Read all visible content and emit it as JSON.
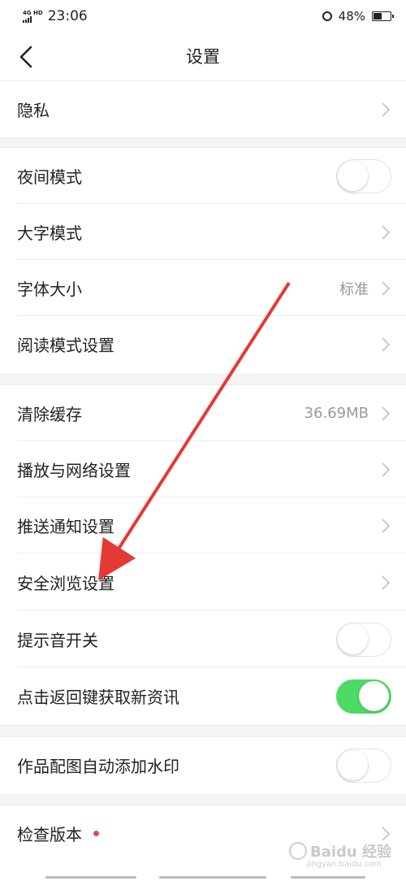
{
  "status_bar": {
    "network": "4G HD",
    "time": "23:06",
    "battery": "48%"
  },
  "navbar": {
    "title": "设置"
  },
  "rows": {
    "privacy": {
      "label": "隐私"
    },
    "night_mode": {
      "label": "夜间模式",
      "on": false
    },
    "large_font_mode": {
      "label": "大字模式"
    },
    "font_size": {
      "label": "字体大小",
      "value": "标准"
    },
    "reading_mode": {
      "label": "阅读模式设置"
    },
    "clear_cache": {
      "label": "清除缓存",
      "value": "36.69MB"
    },
    "playback_network": {
      "label": "播放与网络设置"
    },
    "push_notification": {
      "label": "推送通知设置"
    },
    "safe_browsing": {
      "label": "安全浏览设置"
    },
    "sound_switch": {
      "label": "提示音开关",
      "on": false
    },
    "back_refresh": {
      "label": "点击返回键获取新资讯",
      "on": true
    },
    "watermark": {
      "label": "作品配图自动添加水印",
      "on": false
    },
    "check_version": {
      "label": "检查版本"
    }
  },
  "watermark_logo": {
    "brand": "Baidu 经验",
    "sub": "jingyan.baidu.com"
  },
  "colors": {
    "toggle_on": "#4cd964",
    "annotation_arrow": "#e53935",
    "badge_dot": "#e8484c"
  }
}
